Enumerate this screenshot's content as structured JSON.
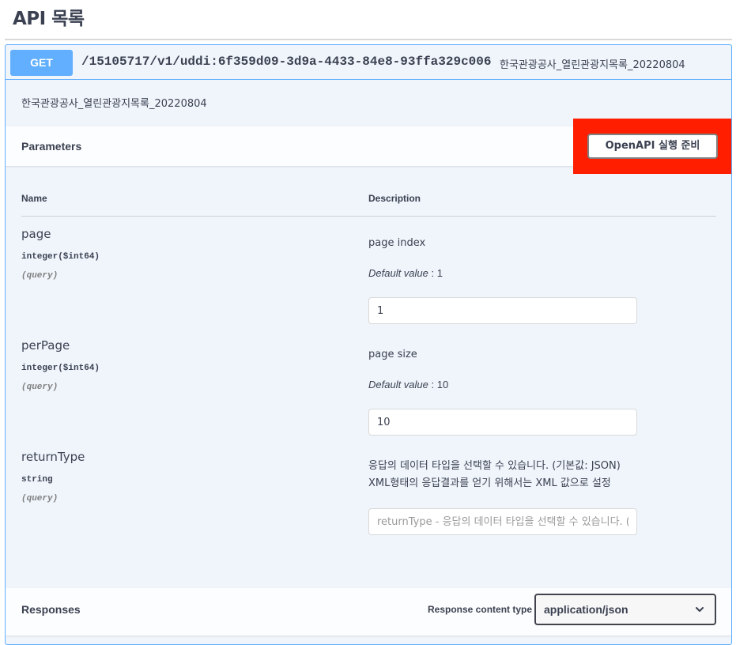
{
  "page": {
    "title": "API 목록"
  },
  "operation": {
    "method": "GET",
    "path": "/15105717/v1/uddi:6f359d09-3d9a-4433-84e8-93ffa329c006",
    "summary": "한국관광공사_열린관광지목록_20220804",
    "description": "한국관광공사_열린관광지목록_20220804"
  },
  "parameters": {
    "title": "Parameters",
    "try_button": "OpenAPI 실행 준비",
    "col_name": "Name",
    "col_description": "Description",
    "items": [
      {
        "name": "page",
        "type": "integer($int64)",
        "in": "(query)",
        "description": "page index",
        "default_label": "Default value",
        "default_value": ": 1",
        "value": "1",
        "placeholder": ""
      },
      {
        "name": "perPage",
        "type": "integer($int64)",
        "in": "(query)",
        "description": "page size",
        "default_label": "Default value",
        "default_value": ": 10",
        "value": "10",
        "placeholder": ""
      },
      {
        "name": "returnType",
        "type": "string",
        "in": "(query)",
        "description_line1": "응답의 데이터 타입을 선택할 수 있습니다. (기본값: JSON)",
        "description_line2": "XML형태의 응답결과를 얻기 위해서는 XML 값으로 설정",
        "value": "",
        "placeholder": "returnType - 응답의 데이터 타입을 선택할 수 있습니다. (기"
      }
    ]
  },
  "responses": {
    "title": "Responses",
    "content_type_label": "Response content type",
    "content_type_value": "application/json"
  },
  "colors": {
    "get_accent": "#61affe",
    "block_bg": "#eff5fb",
    "highlight": "#ff1e00",
    "text": "#3b4151"
  },
  "icons": {
    "select_arrow": "chevron-down-icon"
  }
}
